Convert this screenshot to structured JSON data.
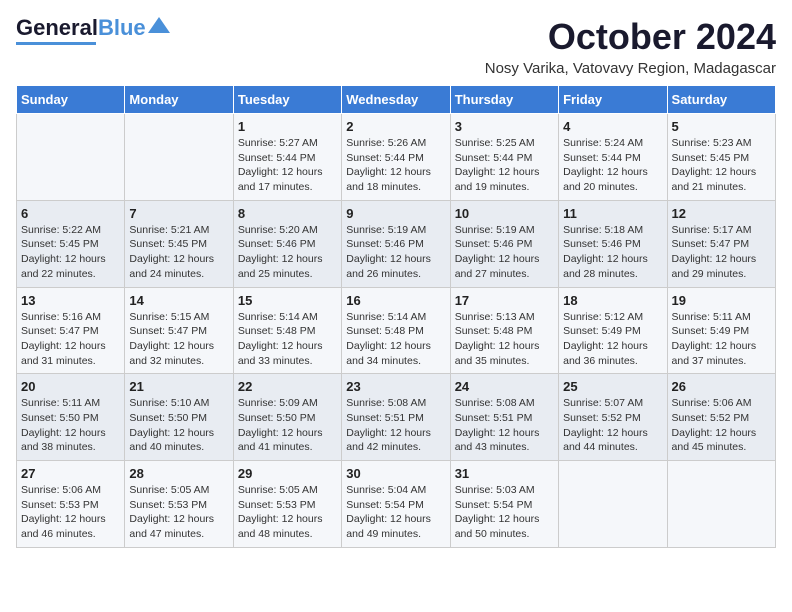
{
  "header": {
    "logo": {
      "line1": "General",
      "line2": "Blue"
    },
    "title": "October 2024",
    "location": "Nosy Varika, Vatovavy Region, Madagascar"
  },
  "columns": [
    "Sunday",
    "Monday",
    "Tuesday",
    "Wednesday",
    "Thursday",
    "Friday",
    "Saturday"
  ],
  "weeks": [
    [
      {
        "day": "",
        "content": ""
      },
      {
        "day": "",
        "content": ""
      },
      {
        "day": "1",
        "content": "Sunrise: 5:27 AM\nSunset: 5:44 PM\nDaylight: 12 hours and 17 minutes."
      },
      {
        "day": "2",
        "content": "Sunrise: 5:26 AM\nSunset: 5:44 PM\nDaylight: 12 hours and 18 minutes."
      },
      {
        "day": "3",
        "content": "Sunrise: 5:25 AM\nSunset: 5:44 PM\nDaylight: 12 hours and 19 minutes."
      },
      {
        "day": "4",
        "content": "Sunrise: 5:24 AM\nSunset: 5:44 PM\nDaylight: 12 hours and 20 minutes."
      },
      {
        "day": "5",
        "content": "Sunrise: 5:23 AM\nSunset: 5:45 PM\nDaylight: 12 hours and 21 minutes."
      }
    ],
    [
      {
        "day": "6",
        "content": "Sunrise: 5:22 AM\nSunset: 5:45 PM\nDaylight: 12 hours and 22 minutes."
      },
      {
        "day": "7",
        "content": "Sunrise: 5:21 AM\nSunset: 5:45 PM\nDaylight: 12 hours and 24 minutes."
      },
      {
        "day": "8",
        "content": "Sunrise: 5:20 AM\nSunset: 5:46 PM\nDaylight: 12 hours and 25 minutes."
      },
      {
        "day": "9",
        "content": "Sunrise: 5:19 AM\nSunset: 5:46 PM\nDaylight: 12 hours and 26 minutes."
      },
      {
        "day": "10",
        "content": "Sunrise: 5:19 AM\nSunset: 5:46 PM\nDaylight: 12 hours and 27 minutes."
      },
      {
        "day": "11",
        "content": "Sunrise: 5:18 AM\nSunset: 5:46 PM\nDaylight: 12 hours and 28 minutes."
      },
      {
        "day": "12",
        "content": "Sunrise: 5:17 AM\nSunset: 5:47 PM\nDaylight: 12 hours and 29 minutes."
      }
    ],
    [
      {
        "day": "13",
        "content": "Sunrise: 5:16 AM\nSunset: 5:47 PM\nDaylight: 12 hours and 31 minutes."
      },
      {
        "day": "14",
        "content": "Sunrise: 5:15 AM\nSunset: 5:47 PM\nDaylight: 12 hours and 32 minutes."
      },
      {
        "day": "15",
        "content": "Sunrise: 5:14 AM\nSunset: 5:48 PM\nDaylight: 12 hours and 33 minutes."
      },
      {
        "day": "16",
        "content": "Sunrise: 5:14 AM\nSunset: 5:48 PM\nDaylight: 12 hours and 34 minutes."
      },
      {
        "day": "17",
        "content": "Sunrise: 5:13 AM\nSunset: 5:48 PM\nDaylight: 12 hours and 35 minutes."
      },
      {
        "day": "18",
        "content": "Sunrise: 5:12 AM\nSunset: 5:49 PM\nDaylight: 12 hours and 36 minutes."
      },
      {
        "day": "19",
        "content": "Sunrise: 5:11 AM\nSunset: 5:49 PM\nDaylight: 12 hours and 37 minutes."
      }
    ],
    [
      {
        "day": "20",
        "content": "Sunrise: 5:11 AM\nSunset: 5:50 PM\nDaylight: 12 hours and 38 minutes."
      },
      {
        "day": "21",
        "content": "Sunrise: 5:10 AM\nSunset: 5:50 PM\nDaylight: 12 hours and 40 minutes."
      },
      {
        "day": "22",
        "content": "Sunrise: 5:09 AM\nSunset: 5:50 PM\nDaylight: 12 hours and 41 minutes."
      },
      {
        "day": "23",
        "content": "Sunrise: 5:08 AM\nSunset: 5:51 PM\nDaylight: 12 hours and 42 minutes."
      },
      {
        "day": "24",
        "content": "Sunrise: 5:08 AM\nSunset: 5:51 PM\nDaylight: 12 hours and 43 minutes."
      },
      {
        "day": "25",
        "content": "Sunrise: 5:07 AM\nSunset: 5:52 PM\nDaylight: 12 hours and 44 minutes."
      },
      {
        "day": "26",
        "content": "Sunrise: 5:06 AM\nSunset: 5:52 PM\nDaylight: 12 hours and 45 minutes."
      }
    ],
    [
      {
        "day": "27",
        "content": "Sunrise: 5:06 AM\nSunset: 5:53 PM\nDaylight: 12 hours and 46 minutes."
      },
      {
        "day": "28",
        "content": "Sunrise: 5:05 AM\nSunset: 5:53 PM\nDaylight: 12 hours and 47 minutes."
      },
      {
        "day": "29",
        "content": "Sunrise: 5:05 AM\nSunset: 5:53 PM\nDaylight: 12 hours and 48 minutes."
      },
      {
        "day": "30",
        "content": "Sunrise: 5:04 AM\nSunset: 5:54 PM\nDaylight: 12 hours and 49 minutes."
      },
      {
        "day": "31",
        "content": "Sunrise: 5:03 AM\nSunset: 5:54 PM\nDaylight: 12 hours and 50 minutes."
      },
      {
        "day": "",
        "content": ""
      },
      {
        "day": "",
        "content": ""
      }
    ]
  ]
}
